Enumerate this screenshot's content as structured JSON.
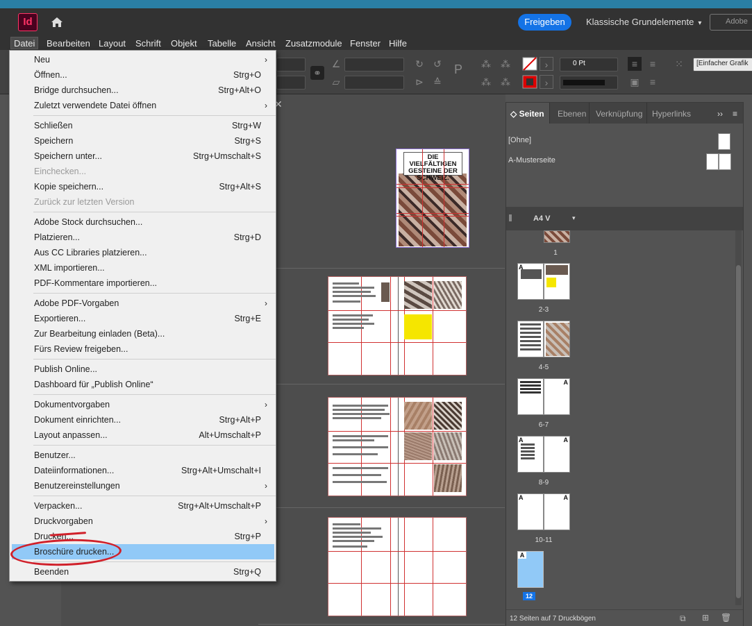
{
  "app": {
    "logo": "Id",
    "share_label": "Freigeben",
    "workspace": "Klassische Grundelemente",
    "search_placeholder": "Adobe"
  },
  "menubar": [
    "Datei",
    "Bearbeiten",
    "Layout",
    "Schrift",
    "Objekt",
    "Tabelle",
    "Ansicht",
    "Zusatzmodule",
    "Fenster",
    "Hilfe"
  ],
  "control": {
    "stroke_weight": "0 Pt",
    "style_field": "[Einfacher Grafik"
  },
  "cover_text": {
    "line1": "DIE VIELFÄLTIGEN",
    "line2": "GESTEINE DER",
    "line3": "SCHWEIZ."
  },
  "panel": {
    "tabs": [
      "Seiten",
      "Ebenen",
      "Verknüpfung",
      "Hyperlinks"
    ],
    "masters": [
      "[Ohne]",
      "A-Musterseite"
    ],
    "size_label": "A4 V",
    "page_labels": [
      "1",
      "2-3",
      "4-5",
      "6-7",
      "8-9",
      "10-11",
      "12"
    ],
    "master_letter": "A",
    "footer": "12 Seiten auf 7 Druckbögen"
  },
  "file_menu": {
    "items": [
      {
        "label": "Neu",
        "shortcut": "",
        "submenu": true,
        "disabled": false
      },
      {
        "label": "Öffnen...",
        "shortcut": "Strg+O",
        "submenu": false,
        "disabled": false
      },
      {
        "label": "Bridge durchsuchen...",
        "shortcut": "Strg+Alt+O",
        "submenu": false,
        "disabled": false
      },
      {
        "label": "Zuletzt verwendete Datei öffnen",
        "shortcut": "",
        "submenu": true,
        "disabled": false
      },
      {
        "label": "Schließen",
        "shortcut": "Strg+W",
        "submenu": false,
        "disabled": false
      },
      {
        "label": "Speichern",
        "shortcut": "Strg+S",
        "submenu": false,
        "disabled": false
      },
      {
        "label": "Speichern unter...",
        "shortcut": "Strg+Umschalt+S",
        "submenu": false,
        "disabled": false
      },
      {
        "label": "Einchecken...",
        "shortcut": "",
        "submenu": false,
        "disabled": true
      },
      {
        "label": "Kopie speichern...",
        "shortcut": "Strg+Alt+S",
        "submenu": false,
        "disabled": false
      },
      {
        "label": "Zurück zur letzten Version",
        "shortcut": "",
        "submenu": false,
        "disabled": true
      },
      {
        "label": "Adobe Stock durchsuchen...",
        "shortcut": "",
        "submenu": false,
        "disabled": false
      },
      {
        "label": "Platzieren...",
        "shortcut": "Strg+D",
        "submenu": false,
        "disabled": false
      },
      {
        "label": "Aus CC Libraries platzieren...",
        "shortcut": "",
        "submenu": false,
        "disabled": false
      },
      {
        "label": "XML importieren...",
        "shortcut": "",
        "submenu": false,
        "disabled": false
      },
      {
        "label": "PDF-Kommentare importieren...",
        "shortcut": "",
        "submenu": false,
        "disabled": false
      },
      {
        "label": "Adobe PDF-Vorgaben",
        "shortcut": "",
        "submenu": true,
        "disabled": false
      },
      {
        "label": "Exportieren...",
        "shortcut": "Strg+E",
        "submenu": false,
        "disabled": false
      },
      {
        "label": "Zur Bearbeitung einladen (Beta)...",
        "shortcut": "",
        "submenu": false,
        "disabled": false
      },
      {
        "label": "Fürs Review freigeben...",
        "shortcut": "",
        "submenu": false,
        "disabled": false
      },
      {
        "label": "Publish Online...",
        "shortcut": "",
        "submenu": false,
        "disabled": false
      },
      {
        "label": "Dashboard für „Publish Online“",
        "shortcut": "",
        "submenu": false,
        "disabled": false
      },
      {
        "label": "Dokumentvorgaben",
        "shortcut": "",
        "submenu": true,
        "disabled": false
      },
      {
        "label": "Dokument einrichten...",
        "shortcut": "Strg+Alt+P",
        "submenu": false,
        "disabled": false
      },
      {
        "label": "Layout anpassen...",
        "shortcut": "Alt+Umschalt+P",
        "submenu": false,
        "disabled": false
      },
      {
        "label": "Benutzer...",
        "shortcut": "",
        "submenu": false,
        "disabled": false
      },
      {
        "label": "Dateiinformationen...",
        "shortcut": "Strg+Alt+Umschalt+I",
        "submenu": false,
        "disabled": false
      },
      {
        "label": "Benutzereinstellungen",
        "shortcut": "",
        "submenu": true,
        "disabled": false
      },
      {
        "label": "Verpacken...",
        "shortcut": "Strg+Alt+Umschalt+P",
        "submenu": false,
        "disabled": false
      },
      {
        "label": "Druckvorgaben",
        "shortcut": "",
        "submenu": true,
        "disabled": false
      },
      {
        "label": "Drucken...",
        "shortcut": "Strg+P",
        "submenu": false,
        "disabled": false
      },
      {
        "label": "Broschüre drucken...",
        "shortcut": "",
        "submenu": false,
        "disabled": false,
        "highlighted": true
      },
      {
        "label": "Beenden",
        "shortcut": "Strg+Q",
        "submenu": false,
        "disabled": false
      }
    ]
  },
  "colors": {
    "accent": "#1473e6",
    "highlight": "#91c9f7",
    "annotation": "#d0202a",
    "guide": "#d03030"
  }
}
